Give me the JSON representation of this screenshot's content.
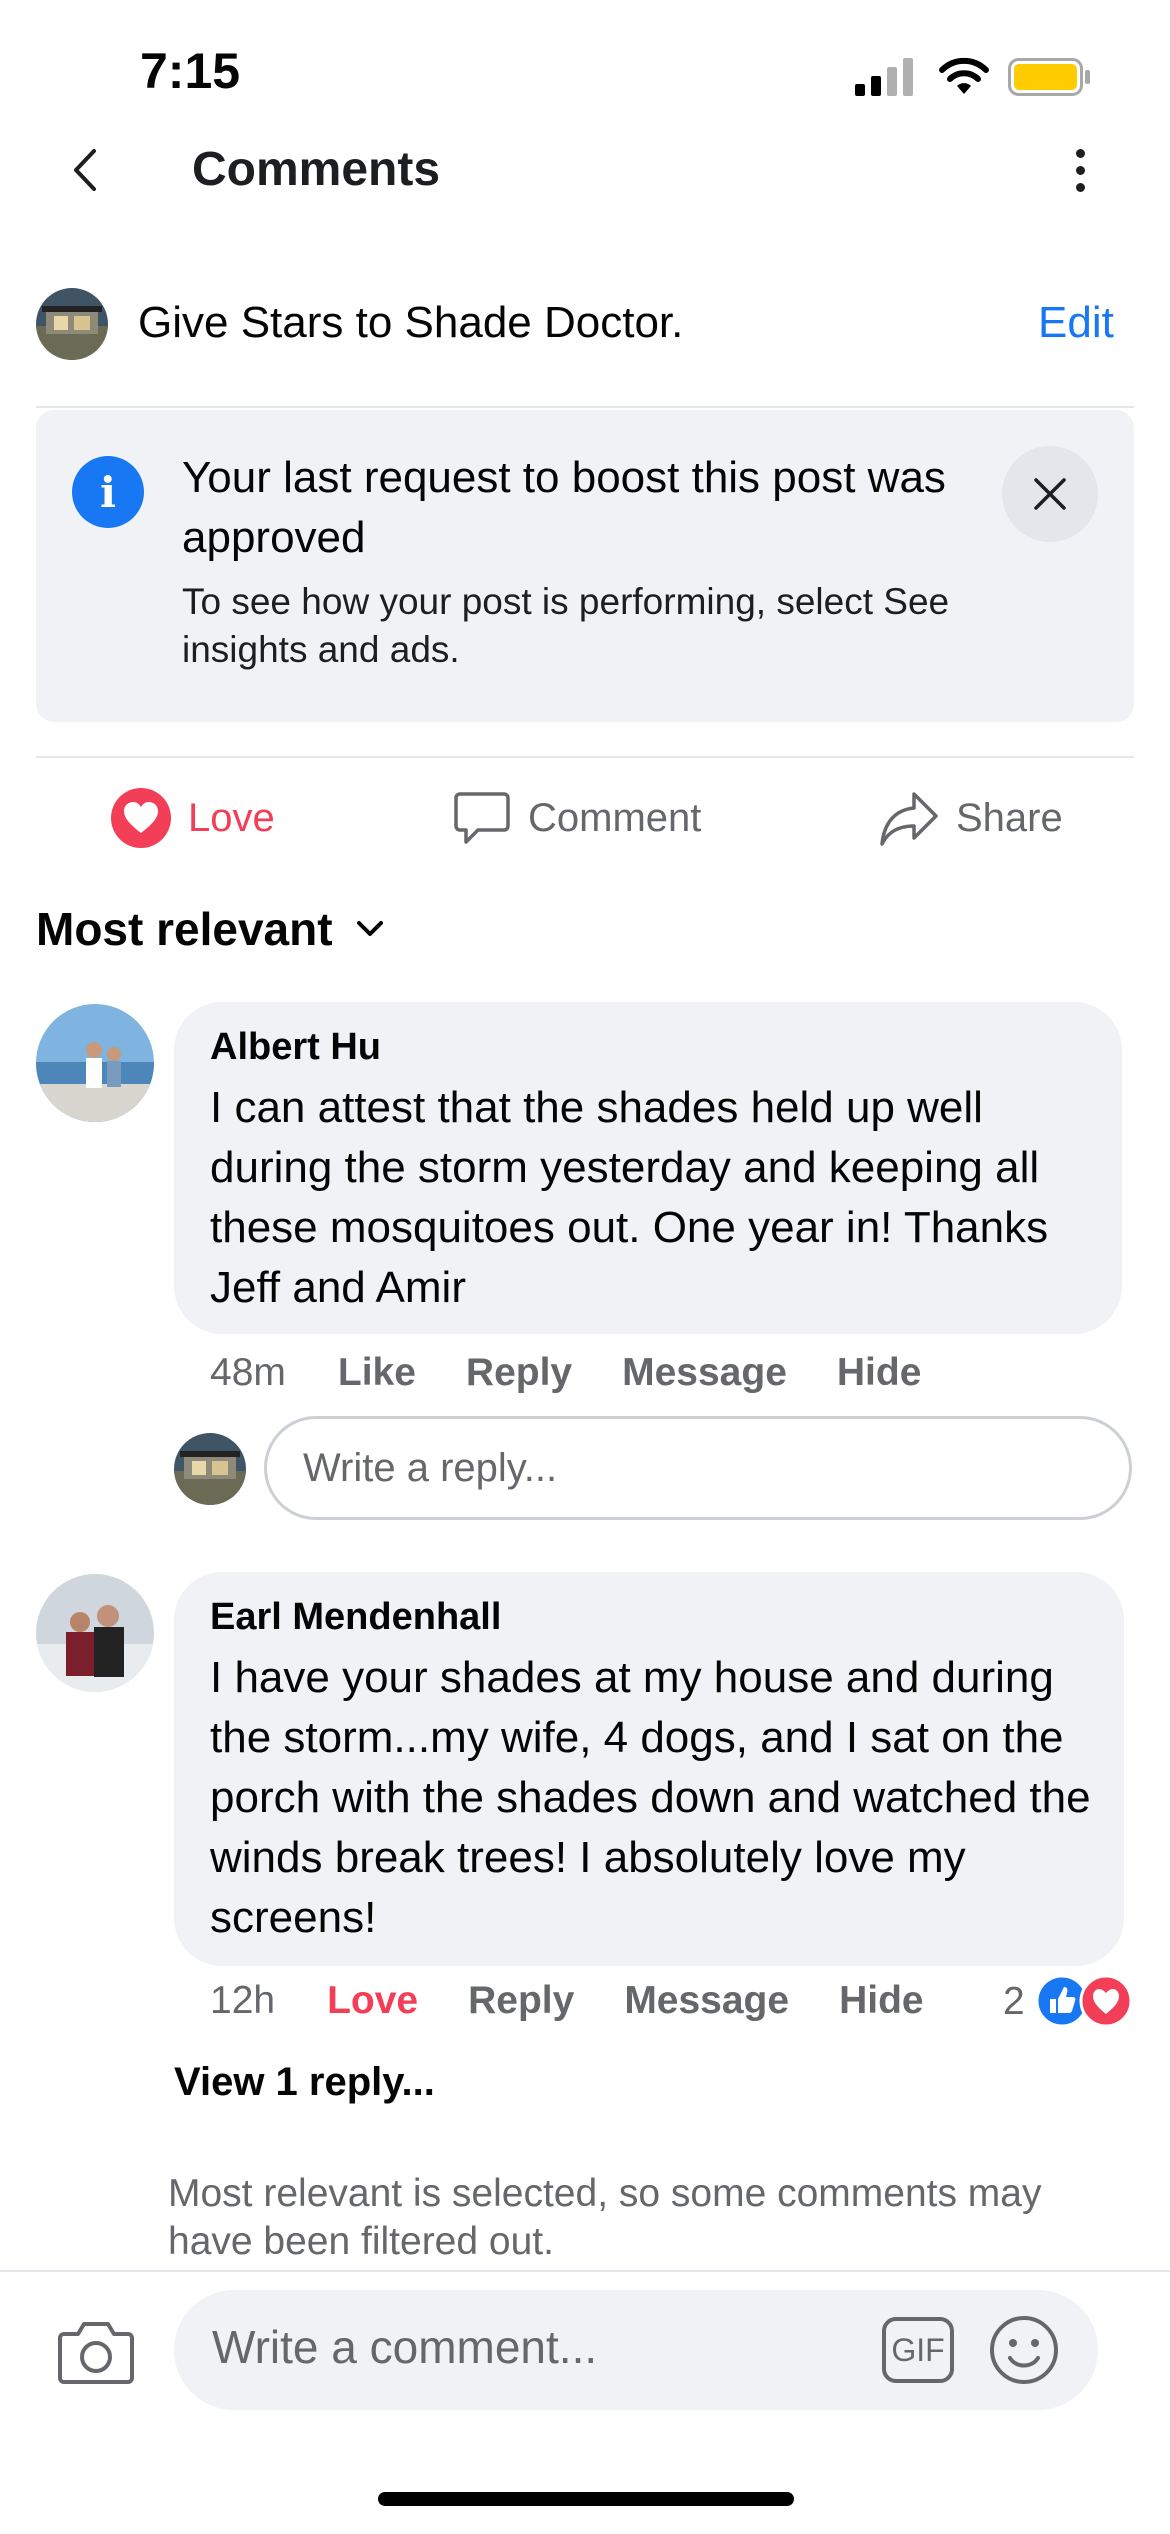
{
  "status_bar": {
    "time": "7:15"
  },
  "header": {
    "title": "Comments"
  },
  "post": {
    "title": "Give Stars to Shade Doctor.",
    "edit_label": "Edit"
  },
  "notice": {
    "title": "Your last request to boost this post was approved",
    "body": "To see how your post is performing, select See insights and ads."
  },
  "actions": {
    "love": "Love",
    "comment": "Comment",
    "share": "Share"
  },
  "sort": {
    "label": "Most relevant"
  },
  "comments": [
    {
      "author": "Albert Hu",
      "text": "I can attest that the shades held up well during the storm yesterday and keeping all these mosquitoes out. One year in! Thanks Jeff and Amir",
      "time": "48m",
      "like": "Like",
      "reply": "Reply",
      "message": "Message",
      "hide": "Hide"
    },
    {
      "author": "Earl Mendenhall",
      "text": "I have your shades at my house and during the storm...my wife, 4 dogs, and I sat on the porch with the shades down and watched the winds break trees! I absolutely love my screens!",
      "time": "12h",
      "like": "Love",
      "reply": "Reply",
      "message": "Message",
      "hide": "Hide",
      "reaction_count": "2"
    }
  ],
  "reply_box": {
    "placeholder": "Write a reply..."
  },
  "view_replies": "View 1 reply...",
  "filter_note": "Most relevant is selected, so some comments may have been filtered out.",
  "composer": {
    "placeholder": "Write a comment...",
    "gif_label": "GIF"
  },
  "colors": {
    "accent": "#1877f2",
    "love": "#f33e58",
    "bubble": "#f0f2f5",
    "muted": "#65676b"
  }
}
